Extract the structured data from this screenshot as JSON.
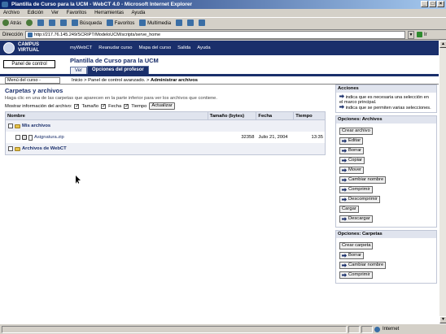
{
  "window": {
    "title": "Plantilla de Curso para la UCM - WebCT 4.0 - Microsoft Internet Explorer"
  },
  "menubar": [
    "Archivo",
    "Edición",
    "Ver",
    "Favoritos",
    "Herramientas",
    "Ayuda"
  ],
  "toolbar": {
    "back": "Atrás",
    "search": "Búsqueda",
    "favorites": "Favoritos",
    "multimedia": "Multimedia"
  },
  "address": {
    "label": "Dirección",
    "url": "http://217.76.145.249/SCRIPT/ModeloUCM/scripts/serve_home",
    "go": "Ir"
  },
  "logo": {
    "line1": "CAMPUS",
    "line2": "VIRTUAL"
  },
  "topnav": [
    "myWebCT",
    "Reanudar curso",
    "Mapa del curso",
    "Salida",
    "Ayuda"
  ],
  "panel_button": "Panel de control",
  "course_title": "Plantilla de Curso para la UCM",
  "tabs": [
    {
      "label": "Ver"
    },
    {
      "label": "Opciones del profesor"
    }
  ],
  "course_menu": "Menú del curso -",
  "breadcrumb": {
    "a": "Inicio",
    "b": "Panel de control avanzado.",
    "c": "Administrar archivos"
  },
  "main": {
    "heading": "Carpetas y archivos",
    "help": "Haga clic en una de las carpetas que aparecen en la parte inferior para ver los archivos que contiene.",
    "show_label": "Mostrar información del archivo:",
    "opt_size": "Tamaño",
    "opt_date": "Fecha",
    "opt_time": "Tiempo",
    "update": "Actualizar"
  },
  "table": {
    "headers": {
      "name": "Nombre",
      "size": "Tamaño (bytes)",
      "date": "Fecha",
      "time": "Tiempo"
    },
    "folder1": "Mis archivos",
    "file1": {
      "name": "Asignatura.zip",
      "size": "32358",
      "date": "Julio 21, 2004",
      "time": "13:35"
    },
    "folder2": "Archivos de WebCT"
  },
  "actions": {
    "title": "Acciones",
    "note1": "indica que es necesaria una selección en el marco principal.",
    "note2": "indica que se permiten varias selecciones."
  },
  "file_options": {
    "title": "Opciones: Archivos",
    "buttons": [
      "Crear archivo",
      "Editar",
      "Borrar",
      "Copiar",
      "Mover",
      "Cambiar nombre",
      "Comprimir",
      "Descomprimir",
      "Cargar",
      "Descargar"
    ]
  },
  "folder_options": {
    "title": "Opciones: Carpetas",
    "buttons": [
      "Crear carpeta",
      "Borrar",
      "Cambiar nombre",
      "Comprimir"
    ]
  },
  "status": {
    "zone": "Internet"
  },
  "colors": {
    "brand": "#1a2f6b",
    "link": "#1a2f6b",
    "chrome": "#d4d0c8"
  }
}
